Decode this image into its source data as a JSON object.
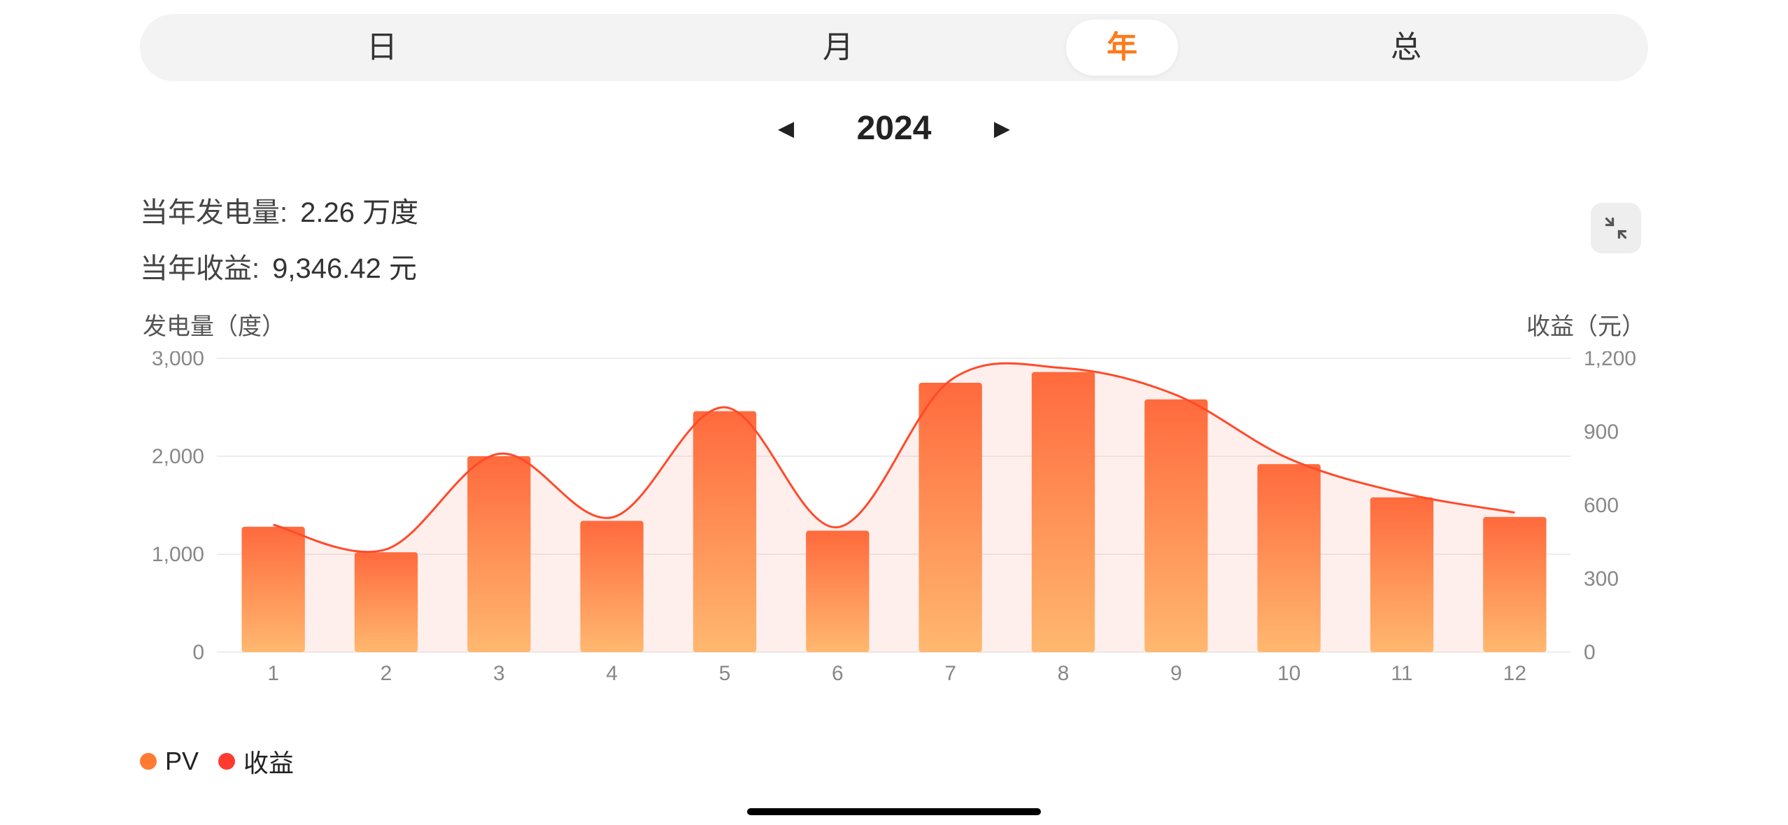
{
  "tabs": {
    "items": [
      "日",
      "月",
      "年",
      "总"
    ],
    "selected": "年"
  },
  "year_selector": {
    "year": "2024"
  },
  "summary": {
    "gen_label": "当年发电量:",
    "gen_value": "2.26 万度",
    "rev_label": "当年收益:",
    "rev_value": "9,346.42 元"
  },
  "axis_titles": {
    "left": "发电量（度）",
    "right": "收益（元）"
  },
  "legend": {
    "pv": {
      "label": "PV",
      "color": "#ff7a33"
    },
    "profit": {
      "label": "收益",
      "color": "#ff3b2f"
    }
  },
  "chart_data": {
    "type": "bar",
    "categories": [
      "1",
      "2",
      "3",
      "4",
      "5",
      "6",
      "7",
      "8",
      "9",
      "10",
      "11",
      "12"
    ],
    "series": [
      {
        "name": "PV",
        "axis": "left",
        "kind": "bar",
        "values": [
          1280,
          1020,
          2000,
          1340,
          2460,
          1240,
          2750,
          2860,
          2580,
          1920,
          1580,
          1380
        ]
      },
      {
        "name": "收益",
        "axis": "right",
        "kind": "line",
        "values": [
          520,
          420,
          810,
          550,
          1000,
          510,
          1110,
          1160,
          1050,
          790,
          650,
          570
        ]
      }
    ],
    "xlabel": "",
    "ylabel_left": "发电量（度）",
    "ylabel_right": "收益（元）",
    "ylim_left": [
      0,
      3000
    ],
    "ylim_right": [
      0,
      1200
    ],
    "y_ticks_left": [
      0,
      1000,
      2000,
      3000
    ],
    "y_ticks_right": [
      0,
      300,
      600,
      900,
      1200
    ],
    "colors": {
      "bar_top": "#ff6a3d",
      "bar_bottom": "#ffb870",
      "line": "#ff4a2a"
    }
  }
}
